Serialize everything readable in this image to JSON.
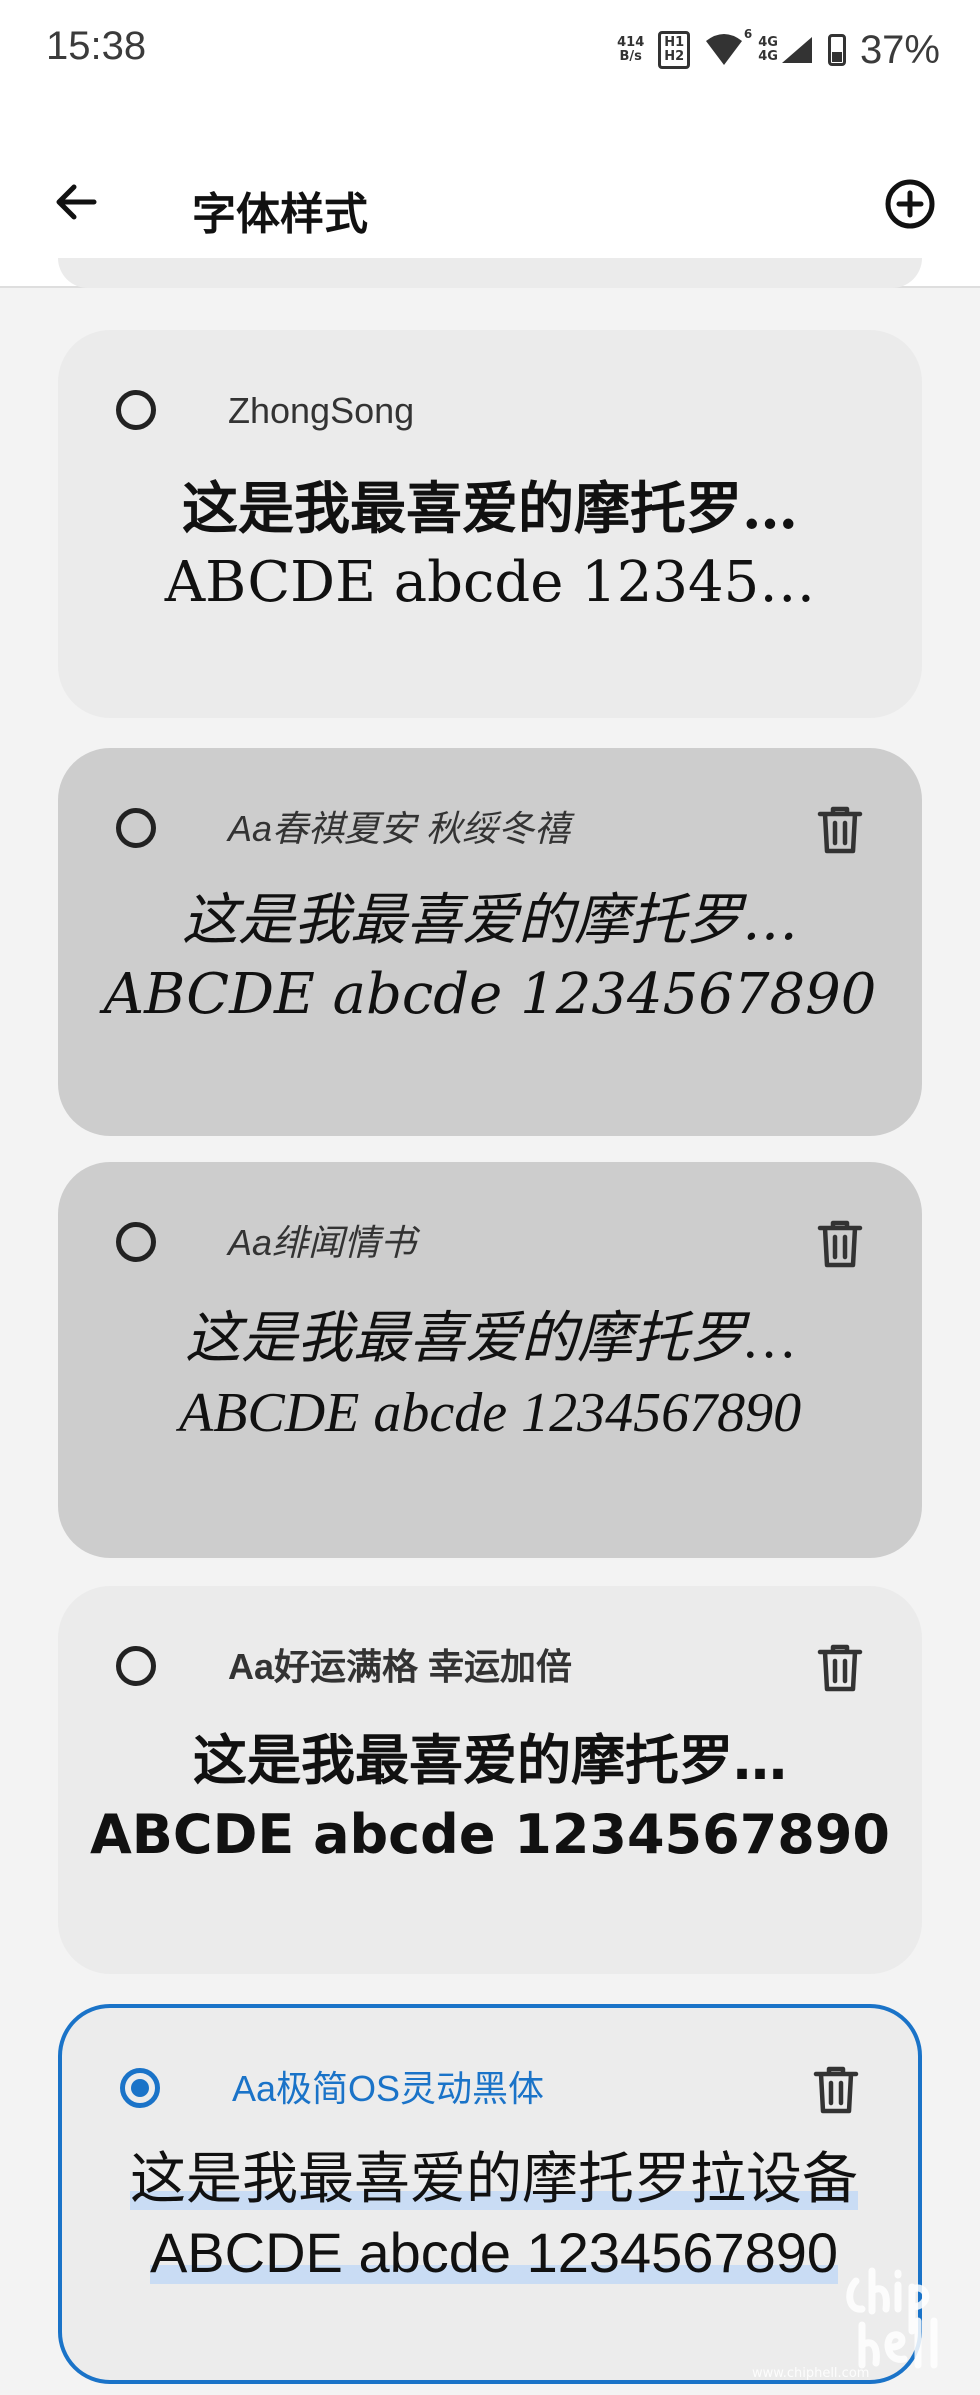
{
  "status_bar": {
    "time": "15:38",
    "net_speed_value": "414",
    "net_speed_unit": "B/s",
    "sim_labels": [
      "H1",
      "H2"
    ],
    "wifi_badge": "6",
    "cell_labels": [
      "4G",
      "4G"
    ],
    "battery": "37%"
  },
  "app_bar": {
    "title": "字体样式",
    "back_icon": "arrow-left-icon",
    "add_icon": "plus-circle-icon"
  },
  "fonts": [
    {
      "name": "ZhongSong",
      "preview_cn": "这是我最喜爱的摩托罗…",
      "preview_en": "ABCDE abcde 12345…",
      "selected": false,
      "deletable": false
    },
    {
      "name": "Aa春祺夏安 秋绥冬禧",
      "preview_cn": "这是我最喜爱的摩托罗…",
      "preview_en": "ABCDE abcde 1234567890",
      "selected": false,
      "deletable": true
    },
    {
      "name": "Aa绯闻情书",
      "preview_cn": "这是我最喜爱的摩托罗…",
      "preview_en": "ABCDE abcde 1234567890",
      "selected": false,
      "deletable": true
    },
    {
      "name": "Aa好运满格 幸运加倍",
      "preview_cn": "这是我最喜爱的摩托罗…",
      "preview_en": "ABCDE abcde 1234567890",
      "selected": false,
      "deletable": true
    },
    {
      "name": "Aa极简OS灵动黑体",
      "preview_cn": "这是我最喜爱的摩托罗拉设备",
      "preview_en": "ABCDE abcde 1234567890",
      "selected": true,
      "deletable": true
    }
  ],
  "colors": {
    "accent": "#1a73c8",
    "card_light": "#ebebeb",
    "card_dark": "#cdcdcd"
  },
  "watermark": "www.chiphell.com"
}
